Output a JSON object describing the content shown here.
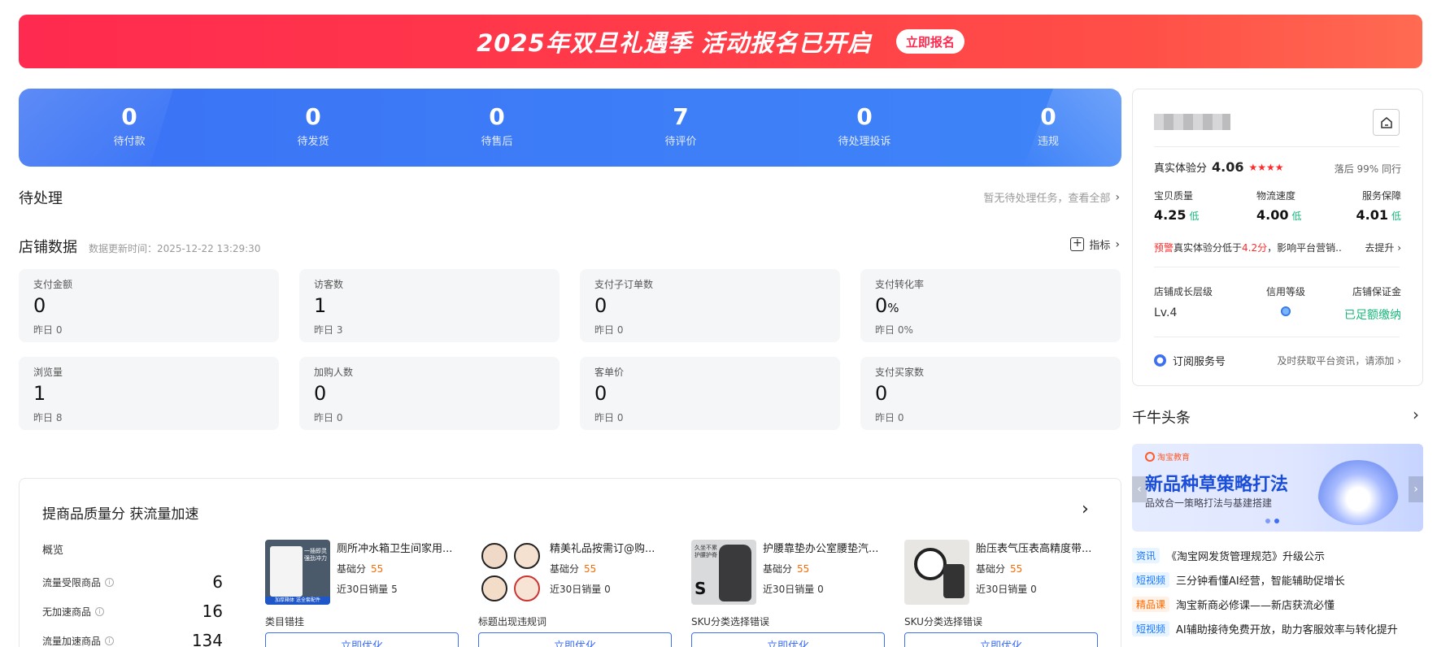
{
  "banner": {
    "title": "2025年双旦礼遇季 活动报名已开启",
    "cta": "立即报名"
  },
  "order_status": [
    {
      "value": "0",
      "label": "待付款"
    },
    {
      "value": "0",
      "label": "待发货"
    },
    {
      "value": "0",
      "label": "待售后"
    },
    {
      "value": "7",
      "label": "待评价"
    },
    {
      "value": "0",
      "label": "待处理投诉"
    },
    {
      "value": "0",
      "label": "违规"
    }
  ],
  "todo": {
    "title": "待处理",
    "link": "暂无待处理任务，查看全部"
  },
  "shop_data": {
    "title": "店铺数据",
    "update_time": "数据更新时间：2025-12-22 13:29:30",
    "indicator": "指标",
    "metrics": [
      {
        "label": "支付金额",
        "value": "0",
        "unit": "",
        "yesterday": "昨日 0"
      },
      {
        "label": "访客数",
        "value": "1",
        "unit": "",
        "yesterday": "昨日 3"
      },
      {
        "label": "支付子订单数",
        "value": "0",
        "unit": "",
        "yesterday": "昨日 0"
      },
      {
        "label": "支付转化率",
        "value": "0",
        "unit": "%",
        "yesterday": "昨日 0%"
      },
      {
        "label": "浏览量",
        "value": "1",
        "unit": "",
        "yesterday": "昨日 8"
      },
      {
        "label": "加购人数",
        "value": "0",
        "unit": "",
        "yesterday": "昨日 0"
      },
      {
        "label": "客单价",
        "value": "0",
        "unit": "",
        "yesterday": "昨日 0"
      },
      {
        "label": "支付买家数",
        "value": "0",
        "unit": "",
        "yesterday": "昨日 0"
      }
    ]
  },
  "quality": {
    "title": "提商品质量分 获流量加速",
    "overview": "概览",
    "rows": [
      {
        "name": "流量受限商品",
        "value": "6"
      },
      {
        "name": "无加速商品",
        "value": "16"
      },
      {
        "name": "流量加速商品",
        "value": "134"
      }
    ],
    "score_label": "基础分",
    "products": [
      {
        "title": "厕所冲水箱卫生间家用...",
        "score": "55",
        "sales": "近30日销量 5",
        "issue": "类目错挂",
        "button": "立即优化"
      },
      {
        "title": "精美礼品按需订@购...",
        "score": "55",
        "sales": "近30日销量 0",
        "issue": "标题出现违规词",
        "button": "立即优化"
      },
      {
        "title": "护腰靠垫办公室腰垫汽...",
        "score": "55",
        "sales": "近30日销量 0",
        "issue": "SKU分类选择错误",
        "button": "立即优化"
      },
      {
        "title": "胎压表气压表高精度带...",
        "score": "55",
        "sales": "近30日销量 0",
        "issue": "SKU分类选择错误",
        "button": "立即优化"
      }
    ],
    "thumb_text": {
      "p1": "一插即灵 强劲冲力",
      "p1_bottom": "加厚箱体 送全套配件",
      "p3": "久坐不累 护腰护脊",
      "p3_letter": "S"
    }
  },
  "shop_card": {
    "experience_label": "真实体验分",
    "experience_score": "4.06",
    "stars": "★★★★",
    "rank": "落后 99% 同行",
    "sub_scores": [
      {
        "label": "宝贝质量",
        "value": "4.25",
        "level": "低"
      },
      {
        "label": "物流速度",
        "value": "4.00",
        "level": "低"
      },
      {
        "label": "服务保障",
        "value": "4.01",
        "level": "低"
      }
    ],
    "warning_tag": "预警",
    "warning_prefix": "真实体验分低于",
    "warning_score": "4.2分",
    "warning_suffix": "，影响平台营销...",
    "improve": "去提升",
    "levels": [
      {
        "label": "店铺成长层级",
        "value": "Lv.4"
      },
      {
        "label": "信用等级",
        "value": ""
      },
      {
        "label": "店铺保证金",
        "value": "已足额缴纳"
      }
    ],
    "subscribe_label": "订阅服务号",
    "subscribe_desc": "及时获取平台资讯，请添加"
  },
  "headlines": {
    "title": "千牛头条",
    "banner_logo": "淘宝教育",
    "banner_title": "新品种草策略打法",
    "banner_sub": "品效合一策略打法与基建搭建",
    "items": [
      {
        "tag": "资讯",
        "text": "《淘宝网发货管理规范》升级公示"
      },
      {
        "tag": "短视频",
        "text": "三分钟看懂AI经营，智能辅助促增长"
      },
      {
        "tag": "精品课",
        "text": "淘宝新商必修课——新店获流必懂"
      },
      {
        "tag": "短视频",
        "text": "AI辅助接待免费开放，助力客服效率与转化提升"
      }
    ]
  },
  "colors": {
    "banner": "#ff2a4f",
    "status_blue": "#3d7cf7",
    "accent_blue": "#3d6ff2",
    "orange": "#ff6a00",
    "green": "#18b87c",
    "red": "#ff2a2a"
  }
}
